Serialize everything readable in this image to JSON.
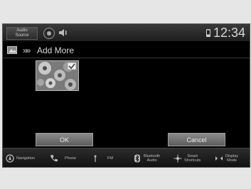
{
  "statusbar": {
    "audio_source_label": "Audio\nSource",
    "clock": "12:34"
  },
  "screen": {
    "title_prefix": "»»",
    "title": "Add More"
  },
  "buttons": {
    "ok_label": "OK",
    "cancel_label": "Cancel"
  },
  "bottom_nav": [
    {
      "label": "Navigation",
      "icon": "navigation-icon"
    },
    {
      "label": "Phone",
      "icon": "phone-icon"
    },
    {
      "label": "FM",
      "icon": "radio-icon"
    },
    {
      "label": "Bluetooth\nAudio",
      "icon": "bluetooth-icon"
    },
    {
      "label": "Smart\nShortcuts",
      "icon": "shortcuts-icon"
    },
    {
      "label": "Display\nMode",
      "icon": "display-mode-icon"
    }
  ]
}
